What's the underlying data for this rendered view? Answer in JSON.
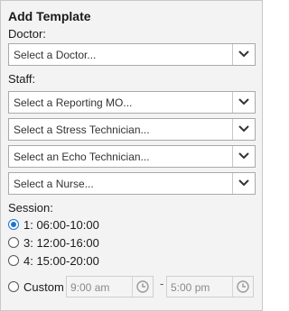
{
  "title": "Add Template",
  "doctor": {
    "label": "Doctor:",
    "placeholder": "Select a Doctor..."
  },
  "staff": {
    "label": "Staff:",
    "selects": [
      {
        "placeholder": "Select a Reporting MO..."
      },
      {
        "placeholder": "Select a Stress Technician..."
      },
      {
        "placeholder": "Select an Echo Technician..."
      },
      {
        "placeholder": "Select a Nurse..."
      }
    ]
  },
  "session": {
    "label": "Session:",
    "options": [
      {
        "label": "1: 06:00-10:00",
        "checked": true
      },
      {
        "label": "3: 12:00-16:00",
        "checked": false
      },
      {
        "label": "4: 15:00-20:00",
        "checked": false
      }
    ],
    "custom": {
      "label": "Custom",
      "start": "9:00 am",
      "separator": "-",
      "end": "5:00 pm"
    }
  },
  "icons": {
    "dropdown": "chevron-down-icon",
    "clock": "clock-icon"
  },
  "colors": {
    "accent": "#1e73d2",
    "panel_bg": "#f3f3f3",
    "border": "#a9a9a9"
  }
}
